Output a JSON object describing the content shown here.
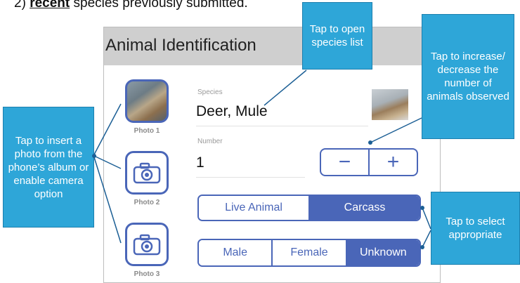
{
  "intro": {
    "prefix": "2) ",
    "keyword": "recent",
    "suffix": " species previously submitted."
  },
  "app": {
    "title": "Animal Identification",
    "photos": [
      {
        "label": "Photo 1",
        "state": "filled"
      },
      {
        "label": "Photo 2",
        "state": "empty"
      },
      {
        "label": "Photo 3",
        "state": "empty"
      }
    ],
    "species": {
      "label": "Species",
      "value": "Deer, Mule"
    },
    "number": {
      "label": "Number",
      "value": "1"
    },
    "stepper": {
      "minus": "−",
      "plus": "+"
    },
    "condition": {
      "options": [
        "Live Animal",
        "Carcass"
      ],
      "selected": "Carcass"
    },
    "sex": {
      "options": [
        "Male",
        "Female",
        "Unknown"
      ],
      "selected": "Unknown"
    }
  },
  "callouts": {
    "species_list": "Tap to open species list",
    "number": "Tap to increase/ decrease the number of animals observed",
    "photo": "Tap to insert a photo from the phone’s album or enable camera option",
    "select": "Tap to select appropriate"
  },
  "colors": {
    "accent": "#4a66b8",
    "callout": "#2ea6d8",
    "header": "#cfcfcf"
  }
}
